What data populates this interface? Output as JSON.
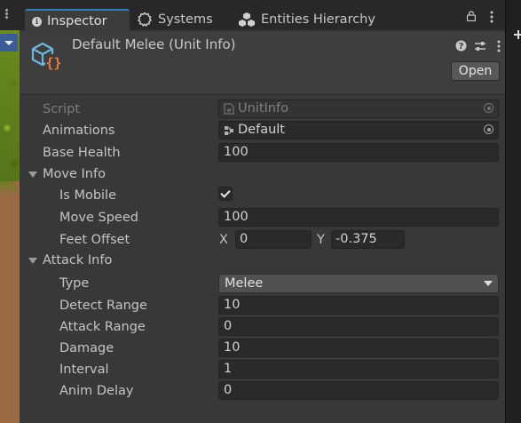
{
  "tabs": {
    "inspector": "Inspector",
    "systems": "Systems",
    "entities": "Entities Hierarchy"
  },
  "header": {
    "title": "Default Melee (Unit Info)",
    "open_label": "Open",
    "icon": "scriptable-object-icon"
  },
  "fields": {
    "script": {
      "label": "Script",
      "value": "UnitInfo"
    },
    "animations": {
      "label": "Animations",
      "value": "Default"
    },
    "base_health": {
      "label": "Base Health",
      "value": "100"
    },
    "move_info": {
      "label": "Move Info",
      "is_mobile": {
        "label": "Is Mobile",
        "checked": true
      },
      "move_speed": {
        "label": "Move Speed",
        "value": "100"
      },
      "feet_offset": {
        "label": "Feet Offset",
        "x_label": "X",
        "x": "0",
        "y_label": "Y",
        "y": "-0.375"
      }
    },
    "attack_info": {
      "label": "Attack Info",
      "type": {
        "label": "Type",
        "value": "Melee"
      },
      "detect_range": {
        "label": "Detect Range",
        "value": "10"
      },
      "attack_range": {
        "label": "Attack Range",
        "value": "0"
      },
      "damage": {
        "label": "Damage",
        "value": "10"
      },
      "interval": {
        "label": "Interval",
        "value": "1"
      },
      "anim_delay": {
        "label": "Anim Delay",
        "value": "0"
      }
    }
  },
  "colors": {
    "panel_bg": "#383838",
    "field_bg": "#2a2a2a",
    "tab_accent": "#3a79bb",
    "icon_blue": "#6fb7e0",
    "icon_orange": "#ee7a3a"
  }
}
